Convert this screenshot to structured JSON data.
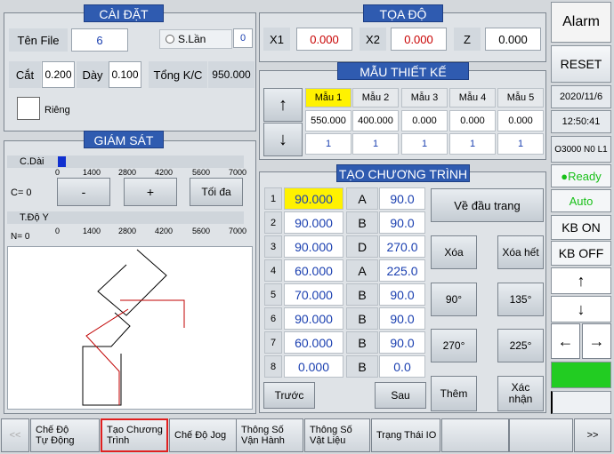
{
  "settings": {
    "title": "CÀI ĐẶT",
    "file_label": "Tên File",
    "file_value": "6",
    "slan_label": "S.Lần",
    "slan_value": "0",
    "cut_label": "Cắt",
    "cut_value": "0.200",
    "thick_label": "Dày",
    "thick_value": "0.100",
    "total_label": "Tổng K/C",
    "total_value": "950.000",
    "rieng_label": "Riêng"
  },
  "coords": {
    "title": "TỌA ĐỘ",
    "x1_label": "X1",
    "x1_value": "0.000",
    "x2_label": "X2",
    "x2_value": "0.000",
    "z_label": "Z",
    "z_value": "0.000"
  },
  "pattern": {
    "title": "MẪU THIẾT KẾ",
    "up": "↑",
    "down": "↓",
    "headers": [
      "Mẫu 1",
      "Mẫu 2",
      "Mẫu 3",
      "Mẫu 4",
      "Mẫu 5"
    ],
    "row1": [
      "550.000",
      "400.000",
      "0.000",
      "0.000",
      "0.000"
    ],
    "row2": [
      "1",
      "1",
      "1",
      "1",
      "1"
    ]
  },
  "monitor": {
    "title": "GIÁM SÁT",
    "cdai_label": "C.Dài",
    "c_label": "C= 0",
    "ticks": [
      "0",
      "1400",
      "2800",
      "4200",
      "5600",
      "7000"
    ],
    "minus": "-",
    "plus": "+",
    "max": "Tối đa",
    "tdoy_label": "T.Độ Y",
    "n_label": "N= 0"
  },
  "program": {
    "title": "TẠO CHƯƠNG TRÌNH",
    "rows": [
      {
        "n": "1",
        "v": "90.000",
        "l": "A",
        "a": "90.0"
      },
      {
        "n": "2",
        "v": "90.000",
        "l": "B",
        "a": "90.0"
      },
      {
        "n": "3",
        "v": "90.000",
        "l": "D",
        "a": "270.0"
      },
      {
        "n": "4",
        "v": "60.000",
        "l": "A",
        "a": "225.0"
      },
      {
        "n": "5",
        "v": "70.000",
        "l": "B",
        "a": "90.0"
      },
      {
        "n": "6",
        "v": "90.000",
        "l": "B",
        "a": "90.0"
      },
      {
        "n": "7",
        "v": "60.000",
        "l": "B",
        "a": "90.0"
      },
      {
        "n": "8",
        "v": "0.000",
        "l": "B",
        "a": "0.0"
      }
    ],
    "first_page": "Về đầu trang",
    "delete": "Xóa",
    "delete_all": "Xóa hết",
    "a90": "90°",
    "a135": "135°",
    "a270": "270°",
    "a225": "225°",
    "add": "Thêm",
    "confirm": "Xác nhận",
    "prev": "Trước",
    "next": "Sau"
  },
  "side": {
    "alarm": "Alarm",
    "reset": "RESET",
    "date": "2020/11/6",
    "time": "12:50:41",
    "code": "O3000 N0 L1",
    "ready": "●Ready",
    "auto": "Auto",
    "kb_on": "KB ON",
    "kb_off": "KB OFF",
    "up": "↑",
    "down": "↓",
    "left": "←",
    "right": "→"
  },
  "tabs": {
    "prev": "<<",
    "t1": "Chế Độ\nTự Động",
    "t2": "Tạo Chương\nTrình",
    "t3": "Chế Độ Jog",
    "t4": "Thông Số\nVận Hành",
    "t5": "Thông Số\nVật Liệu",
    "t6": "Trạng Thái IO",
    "next": ">>"
  }
}
